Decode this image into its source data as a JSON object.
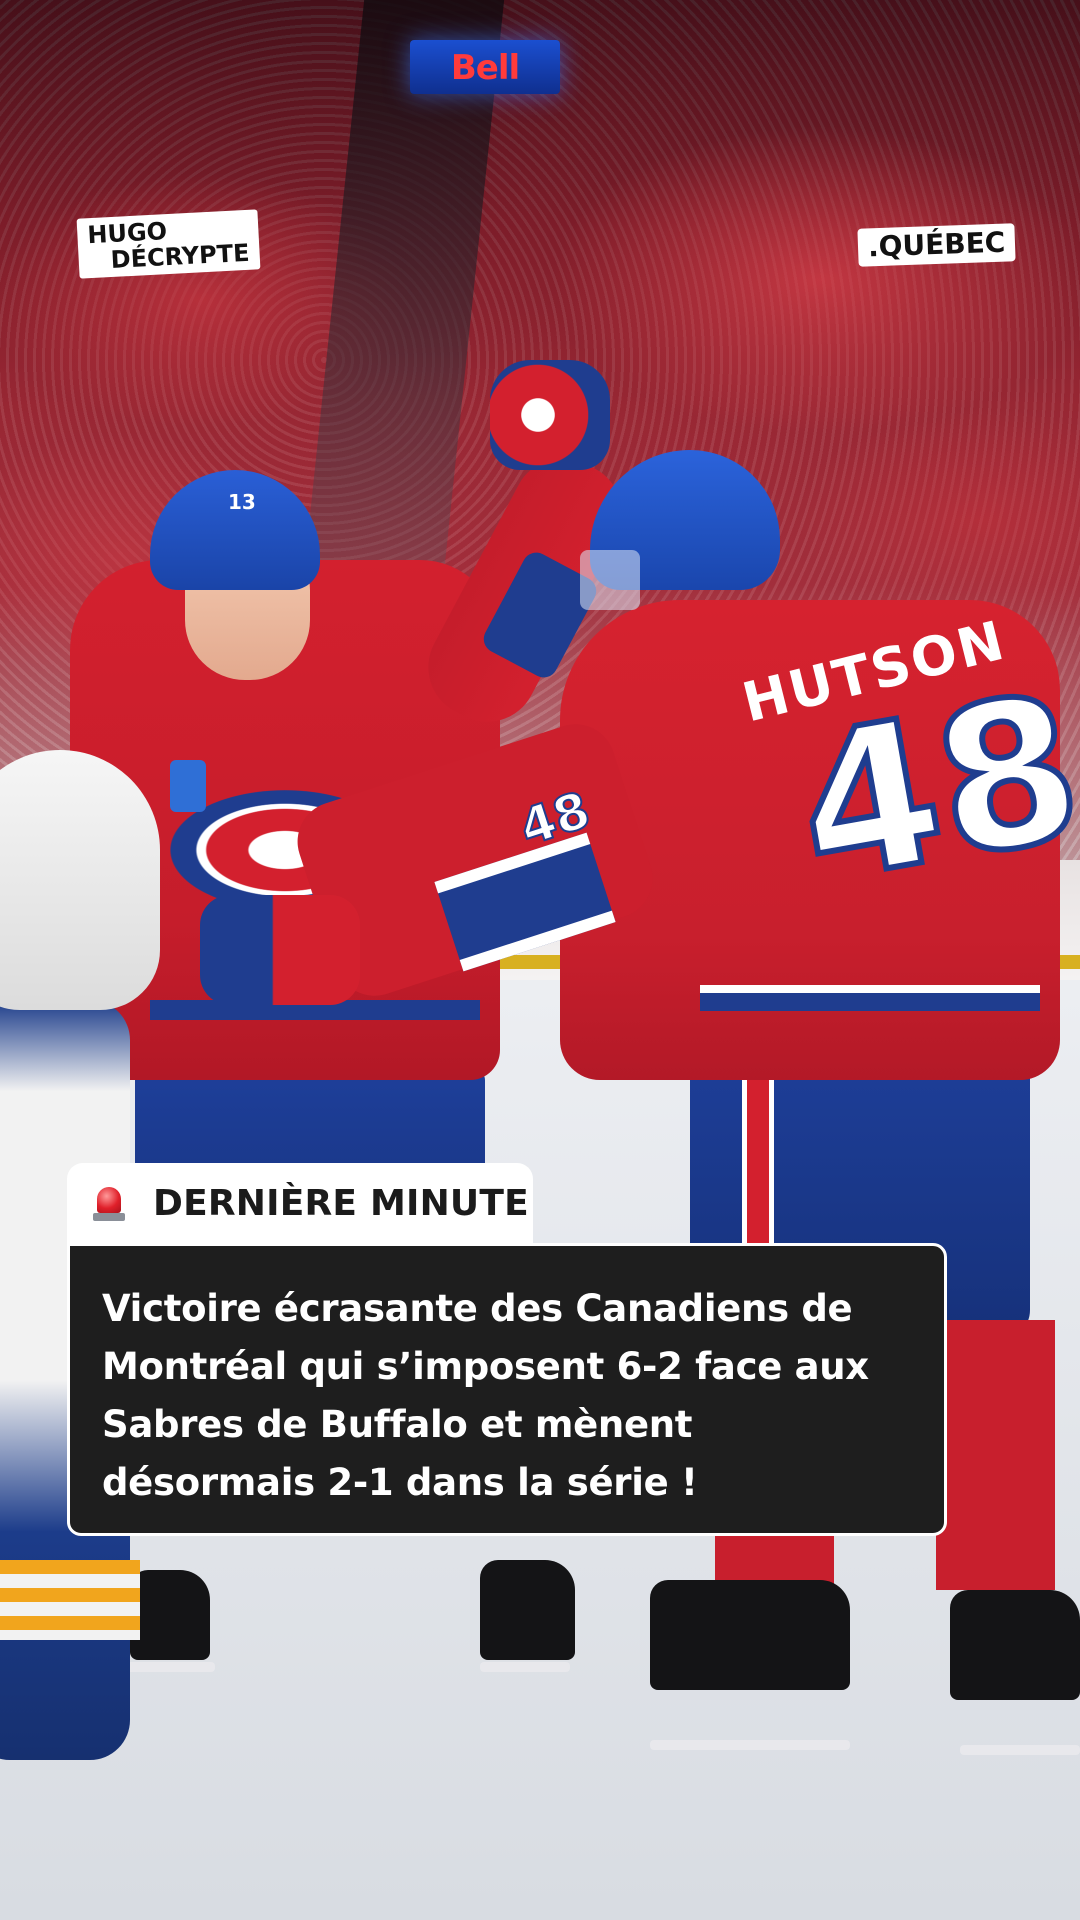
{
  "photo": {
    "description_icon": "hockey-celebration-photo",
    "scoreboard_text": "Bell",
    "player_name": "HUTSON",
    "player_number": "48",
    "arm_number": "48",
    "helmet_number_left": "13"
  },
  "branding": {
    "hugo_line1": "HUGO",
    "hugo_line2": "DÉCRYPTE",
    "region": ".QUÉBEC"
  },
  "alert": {
    "icon": "siren-icon",
    "label": "DERNIÈRE MINUTE"
  },
  "headline": {
    "text": "Victoire écrasante des Canadiens de Montréal qui s’imposent 6-2 face aux Sabres de Buffalo et mènent désormais 2-1 dans la série !"
  },
  "colors": {
    "canadiens_red": "#d3202e",
    "canadiens_blue": "#1f3d8f",
    "news_box_bg": "#1e1e1e",
    "tag_bg": "#ffffff"
  }
}
